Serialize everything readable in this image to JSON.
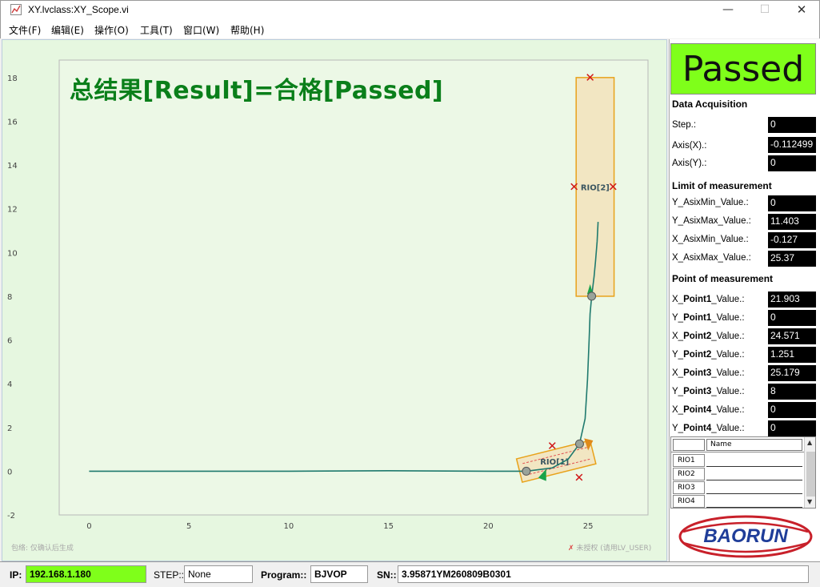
{
  "window": {
    "title": "XY.lvclass:XY_Scope.vi"
  },
  "menu": [
    "文件(F)",
    "编辑(E)",
    "操作(O)",
    "工具(T)",
    "窗口(W)",
    "帮助(H)"
  ],
  "result_banner": "总结果[Result]=合格[Passed]",
  "status_box": "Passed",
  "chart_data": {
    "type": "line",
    "x_ticks": [
      "0",
      "5",
      "10",
      "15",
      "20",
      "25"
    ],
    "y_ticks": [
      "-2",
      "0",
      "2",
      "4",
      "6",
      "8",
      "10",
      "12",
      "14",
      "16",
      "18"
    ],
    "xlim": [
      -1.5,
      28
    ],
    "ylim": [
      -2,
      18.8
    ],
    "grid": false,
    "background": "#e6f7e0",
    "trace_color": "#1f7a6e",
    "series": [
      {
        "x": [
          0,
          5,
          10,
          15,
          20,
          21.9,
          23.2,
          24.0,
          24.571,
          24.85,
          24.97,
          25.05,
          25.1,
          25.179,
          25.3,
          25.37,
          25.45,
          25.5
        ],
        "y": [
          0,
          0,
          0,
          0.02,
          0,
          0,
          0.15,
          0.55,
          1.251,
          2.4,
          4.2,
          6.0,
          7.2,
          8,
          8.9,
          9.6,
          10.5,
          11.4
        ]
      }
    ],
    "regions": [
      {
        "name": "RIO[1]",
        "kind": "rotated-box",
        "center": [
          23.4,
          0.45
        ],
        "width": 3.8,
        "height": 1.1,
        "angle_deg": -14
      },
      {
        "name": "RIO[2]",
        "kind": "box",
        "x": [
          24.4,
          26.3
        ],
        "y": [
          8,
          18
        ]
      }
    ],
    "markers_x": [
      [
        25.1,
        18
      ],
      [
        24.3,
        13
      ],
      [
        26.25,
        13
      ],
      [
        23.2,
        1.15
      ],
      [
        24.55,
        -0.3
      ]
    ],
    "points": [
      [
        21.903,
        0
      ],
      [
        24.571,
        1.251
      ],
      [
        25.179,
        8
      ]
    ],
    "footer_left": "包络: 仅确认后生成",
    "footer_right": "未授权 (请用LV_USER)"
  },
  "panel": {
    "data_acq": {
      "title": "Data Acquisition",
      "rows": [
        {
          "label": "Step.:",
          "value": "0"
        },
        {
          "label": "Axis(X).:",
          "value": "-0.112499"
        },
        {
          "label": "Axis(Y).:",
          "value": "0"
        }
      ]
    },
    "limit": {
      "title": "Limit of measurement",
      "rows": [
        {
          "label": "Y_AsixMin_Value.:",
          "value": "0"
        },
        {
          "label": "Y_AsixMax_Value.:",
          "value": "11.403"
        },
        {
          "label": "X_AsixMin_Value.:",
          "value": "-0.127"
        },
        {
          "label": "X_AsixMax_Value.:",
          "value": "25.37"
        }
      ]
    },
    "points": {
      "title": "Point of measurement",
      "rows": [
        {
          "pre": "X_",
          "bold": "Point1",
          "post": "_Value.:",
          "value": "21.903"
        },
        {
          "pre": "Y_",
          "bold": "Point1",
          "post": "_Value.:",
          "value": "0"
        },
        {
          "pre": "X_",
          "bold": "Point2",
          "post": "_Value.:",
          "value": "24.571"
        },
        {
          "pre": "Y_",
          "bold": "Point2",
          "post": "_Value.:",
          "value": "1.251"
        },
        {
          "pre": "X_",
          "bold": "Point3",
          "post": "_Value.:",
          "value": "25.179"
        },
        {
          "pre": "Y_",
          "bold": "Point3",
          "post": "_Value.:",
          "value": "8"
        },
        {
          "pre": "X_",
          "bold": "Point4",
          "post": "_Value.:",
          "value": "0"
        },
        {
          "pre": "Y_",
          "bold": "Point4",
          "post": "_Value.:",
          "value": "0"
        }
      ]
    },
    "rio_table": {
      "header": "Name",
      "rows": [
        "RIO1",
        "RIO2",
        "RIO3",
        "RIO4"
      ]
    },
    "logo_text": "BAORUN"
  },
  "status": {
    "ip_label": "IP:",
    "ip": "192.168.1.180",
    "step_label": "STEP::",
    "step": "None",
    "program_label": "Program::",
    "program": "BJVOP",
    "sn_label": "SN::",
    "sn": "3.95871YM260809B0301"
  }
}
